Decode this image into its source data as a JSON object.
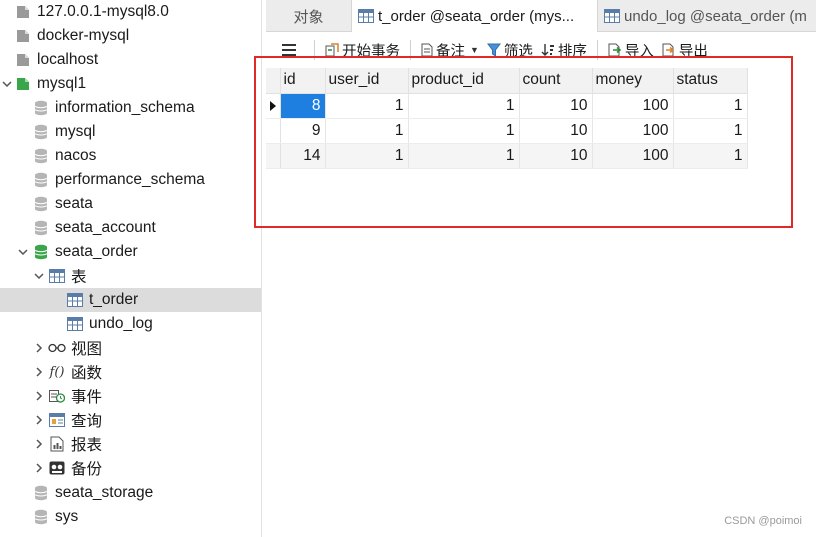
{
  "sidebar": {
    "items": [
      {
        "label": "127.0.0.1-mysql8.0",
        "icon": "connection-icon"
      },
      {
        "label": "docker-mysql",
        "icon": "connection-icon"
      },
      {
        "label": "localhost",
        "icon": "connection-icon"
      },
      {
        "label": "mysql1",
        "icon": "connection-active-icon"
      },
      {
        "label": "information_schema",
        "icon": "database-icon"
      },
      {
        "label": "mysql",
        "icon": "database-icon"
      },
      {
        "label": "nacos",
        "icon": "database-icon"
      },
      {
        "label": "performance_schema",
        "icon": "database-icon"
      },
      {
        "label": "seata",
        "icon": "database-icon"
      },
      {
        "label": "seata_account",
        "icon": "database-icon"
      },
      {
        "label": "seata_order",
        "icon": "database-active-icon"
      },
      {
        "label": "表",
        "icon": "table-folder-icon"
      },
      {
        "label": "t_order",
        "icon": "table-icon"
      },
      {
        "label": "undo_log",
        "icon": "table-icon"
      },
      {
        "label": "视图",
        "icon": "view-icon"
      },
      {
        "label": "函数",
        "icon": "function-icon"
      },
      {
        "label": "事件",
        "icon": "event-icon"
      },
      {
        "label": "查询",
        "icon": "query-icon"
      },
      {
        "label": "报表",
        "icon": "report-icon"
      },
      {
        "label": "备份",
        "icon": "backup-icon"
      },
      {
        "label": "seata_storage",
        "icon": "database-icon"
      },
      {
        "label": "sys",
        "icon": "database-icon"
      }
    ]
  },
  "tabs": [
    {
      "label": "对象"
    },
    {
      "label": "t_order @seata_order (mys..."
    },
    {
      "label": "undo_log @seata_order (m"
    }
  ],
  "toolbar": {
    "begin_txn": "开始事务",
    "note": "备注",
    "filter": "筛选",
    "sort": "排序",
    "import": "导入",
    "export": "导出"
  },
  "grid": {
    "columns": [
      "id",
      "user_id",
      "product_id",
      "count",
      "money",
      "status"
    ],
    "rows": [
      [
        "8",
        "1",
        "1",
        "10",
        "100",
        "1"
      ],
      [
        "9",
        "1",
        "1",
        "10",
        "100",
        "1"
      ],
      [
        "14",
        "1",
        "1",
        "10",
        "100",
        "1"
      ]
    ]
  },
  "watermark": "CSDN @poimoi",
  "colors": {
    "selection": "#1e7fe0",
    "highlight_box": "#e02a2a",
    "db_active": "#3aa64a"
  }
}
